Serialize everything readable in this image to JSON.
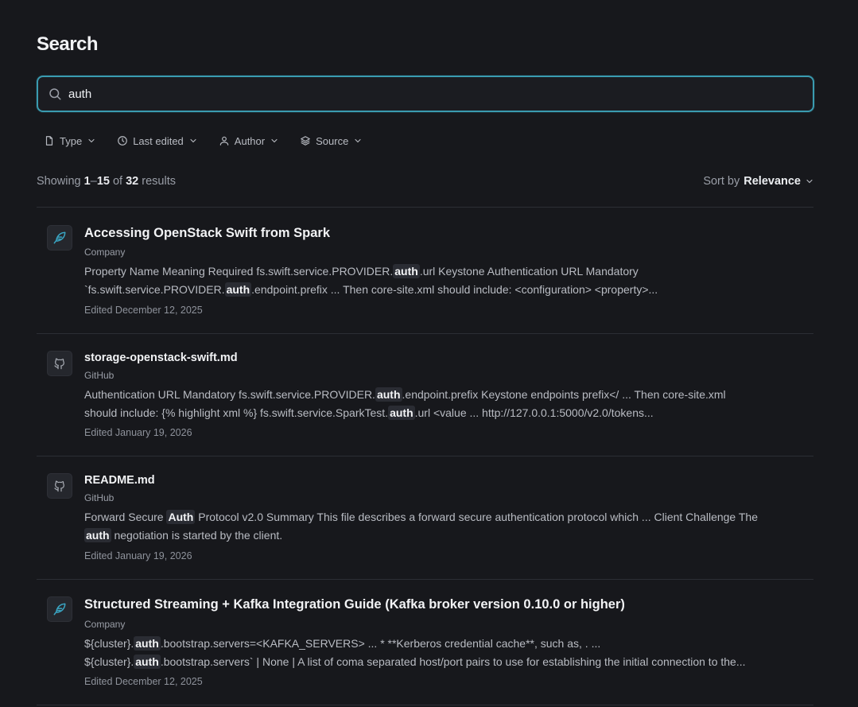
{
  "page": {
    "title": "Search"
  },
  "search": {
    "value": "auth",
    "placeholder": "Search"
  },
  "filters": [
    {
      "label": "Type",
      "icon": "file-icon"
    },
    {
      "label": "Last edited",
      "icon": "clock-icon"
    },
    {
      "label": "Author",
      "icon": "user-icon"
    },
    {
      "label": "Source",
      "icon": "layers-icon"
    }
  ],
  "summary": {
    "prefix": "Showing",
    "range_start": "1",
    "range_sep": "–",
    "range_end": "15",
    "of": "of",
    "total": "32",
    "suffix": "results"
  },
  "sort": {
    "label": "Sort by",
    "value": "Relevance"
  },
  "colors": {
    "accent": "#3a9bb0",
    "background": "#17181c",
    "icon_feather": "#3aa6c4"
  },
  "results": [
    {
      "title": "Accessing OpenStack Swift from Spark",
      "source": "Company",
      "icon": "feather-icon",
      "snippet_lines": [
        [
          {
            "t": "Property Name Meaning Required fs.swift.service.PROVIDER."
          },
          {
            "t": "auth",
            "hl": true
          },
          {
            "t": ".url Keystone Authentication URL Mandatory"
          }
        ],
        [
          {
            "t": "`fs.swift.service.PROVIDER."
          },
          {
            "t": "auth",
            "hl": true
          },
          {
            "t": ".endpoint.prefix ... Then core-site.xml should include: <configuration> <property>..."
          }
        ]
      ],
      "edited": "Edited December 12, 2025"
    },
    {
      "title": "storage-openstack-swift.md",
      "source": "GitHub",
      "icon": "github-icon",
      "snippet_lines": [
        [
          {
            "t": "Authentication URL Mandatory fs.swift.service.PROVIDER."
          },
          {
            "t": "auth",
            "hl": true
          },
          {
            "t": ".endpoint.prefix Keystone endpoints prefix</ ... Then core-site.xml"
          }
        ],
        [
          {
            "t": "should include: {% highlight xml %} fs.swift.service.SparkTest."
          },
          {
            "t": "auth",
            "hl": true
          },
          {
            "t": ".url <value ... http://127.0.0.1:5000/v2.0/tokens..."
          }
        ]
      ],
      "edited": "Edited January 19, 2026"
    },
    {
      "title": "README.md",
      "source": "GitHub",
      "icon": "github-icon",
      "snippet_lines": [
        [
          {
            "t": "Forward Secure "
          },
          {
            "t": "Auth",
            "hl": true
          },
          {
            "t": " Protocol v2.0 Summary This file describes a forward secure authentication protocol which ... Client Challenge The"
          }
        ],
        [
          {
            "t": "auth",
            "hl": true
          },
          {
            "t": " negotiation is started by the client."
          }
        ]
      ],
      "edited": "Edited January 19, 2026"
    },
    {
      "title": "Structured Streaming + Kafka Integration Guide (Kafka broker version 0.10.0 or higher)",
      "source": "Company",
      "icon": "feather-icon",
      "snippet_lines": [
        [
          {
            "t": "${cluster}."
          },
          {
            "t": "auth",
            "hl": true
          },
          {
            "t": ".bootstrap.servers=<KAFKA_SERVERS> ... * **Kerberos credential cache**, such as, . ..."
          }
        ],
        [
          {
            "t": "${cluster}."
          },
          {
            "t": "auth",
            "hl": true
          },
          {
            "t": ".bootstrap.servers` | None | A list of coma separated host/port pairs to use for establishing the initial connection to the..."
          }
        ]
      ],
      "edited": "Edited December 12, 2025"
    }
  ]
}
